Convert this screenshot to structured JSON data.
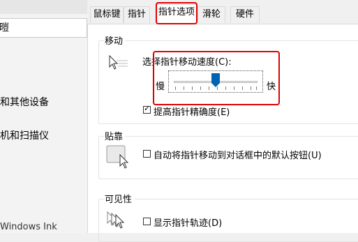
{
  "background_window": {
    "search_text": "暟",
    "items": [
      "和其他设备",
      "机和扫描仪",
      "Windows Ink"
    ]
  },
  "dialog": {
    "tabs": [
      "鼠标键",
      "指针",
      "指针选项",
      "滑轮",
      "硬件"
    ],
    "active_tab_index": 2,
    "motion": {
      "title": "移动",
      "speed_label": "选择指针移动速度(C):",
      "slow_label": "慢",
      "fast_label": "快",
      "speed_fraction": 0.5,
      "precision_label": "提高指针精确度(E)",
      "precision_checked": true
    },
    "snap_to": {
      "title": "贴靠",
      "label": "自动将指针移动到对话框中的默认按钮(U)",
      "checked": false
    },
    "visibility": {
      "title": "可见性",
      "trails_label": "显示指针轨迹(D)",
      "trails_checked": false
    }
  },
  "colors": {
    "highlight_red": "#e00000",
    "slider_thumb": "#0063b1"
  }
}
